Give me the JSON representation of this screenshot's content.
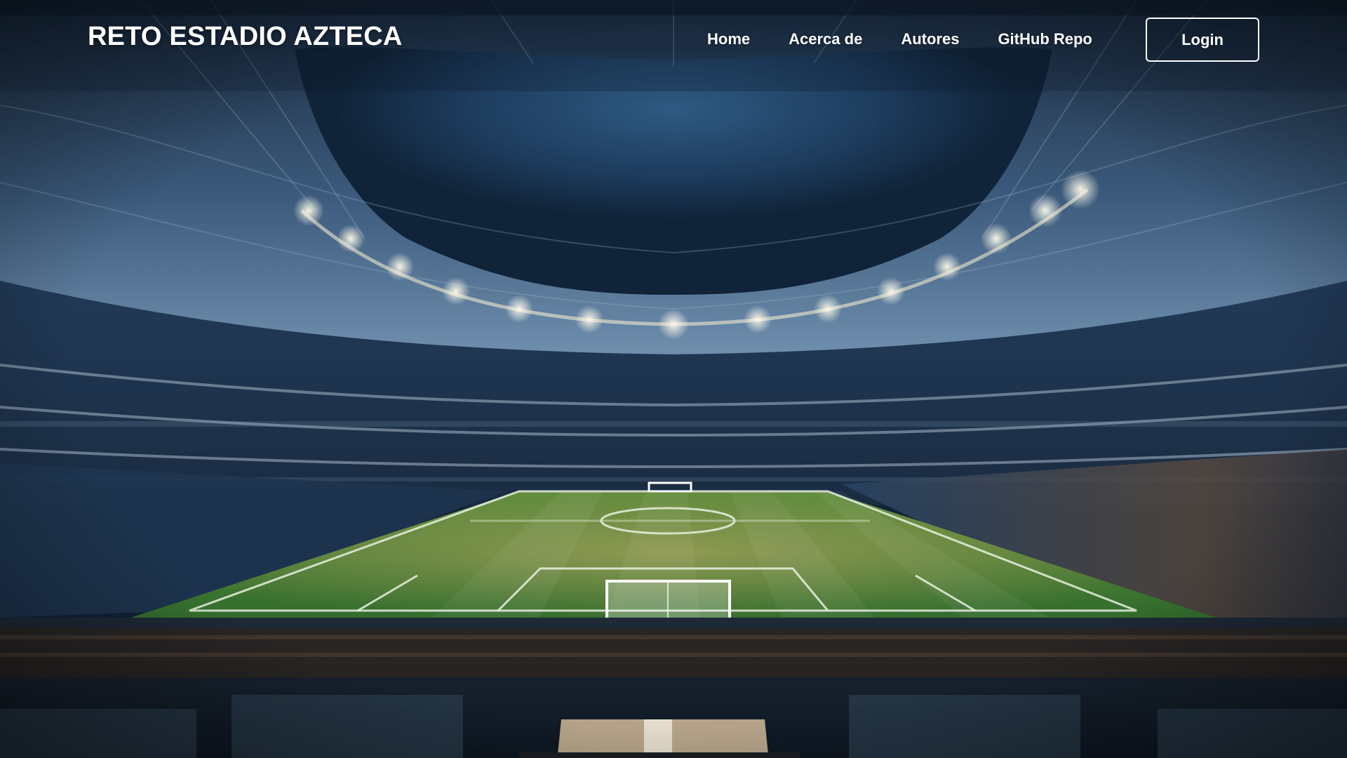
{
  "brand": {
    "title": "RETO ESTADIO AZTECA"
  },
  "nav": {
    "links": [
      {
        "label": "Home"
      },
      {
        "label": "Acerca de"
      },
      {
        "label": "Autores"
      },
      {
        "label": "GitHub Repo"
      }
    ],
    "login_label": "Login"
  },
  "hero": {
    "background": "night-stadium-illustration",
    "colors": {
      "sky": "#1c3a5a",
      "pitch": "#3f7a34",
      "crowd": "#2a4766",
      "lights": "#fff8e6"
    }
  }
}
